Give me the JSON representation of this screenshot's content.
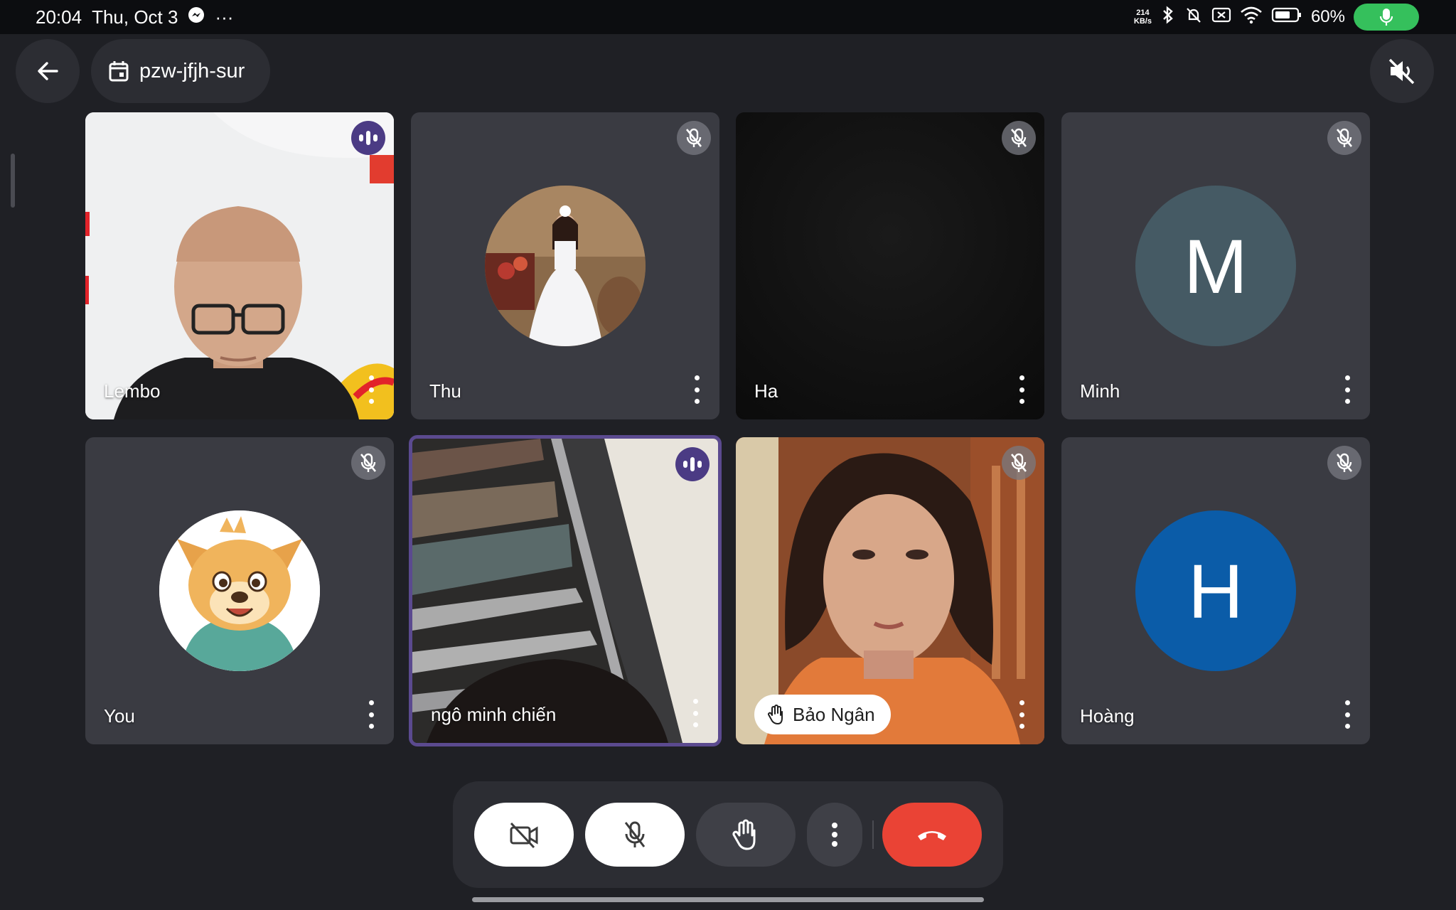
{
  "status_bar": {
    "time": "20:04",
    "date": "Thu, Oct 3",
    "overflow": "···",
    "net_speed_value": "214",
    "net_speed_unit": "KB/s",
    "battery_percent": "60%",
    "icons": [
      "messenger-icon",
      "bluetooth-icon",
      "bell-off-icon",
      "no-sim-icon",
      "wifi-icon",
      "battery-icon",
      "mic-active-icon"
    ],
    "mic_active_color": "#35c05c"
  },
  "header": {
    "meeting_code": "pzw-jfjh-sur",
    "back_icon": "arrow-left-icon",
    "calendar_icon": "calendar-icon",
    "speaker_icon": "speaker-off-icon"
  },
  "participants": [
    {
      "name": "Lembo",
      "state": "talking",
      "media": "video"
    },
    {
      "name": "Thu",
      "state": "muted",
      "media": "photo-avatar"
    },
    {
      "name": "Ha",
      "state": "muted",
      "media": "video-dark"
    },
    {
      "name": "Minh",
      "state": "muted",
      "media": "letter-avatar",
      "initial": "M",
      "avatar_color": "#455a64"
    },
    {
      "name": "You",
      "state": "muted",
      "media": "photo-avatar"
    },
    {
      "name": "ngô minh chiến",
      "state": "talking",
      "media": "video",
      "active_speaker": true
    },
    {
      "name": "Bảo Ngân",
      "state": "muted",
      "media": "video",
      "hand_raised": true
    },
    {
      "name": "Hoàng",
      "state": "muted",
      "media": "letter-avatar",
      "initial": "H",
      "avatar_color": "#0b5ca8"
    }
  ],
  "controls": {
    "camera": "camera-off-icon",
    "mic": "mic-off-icon",
    "raise_hand": "hand-icon",
    "more": "more-vert-icon",
    "end_call": "end-call-icon",
    "end_call_color": "#ea4335"
  }
}
